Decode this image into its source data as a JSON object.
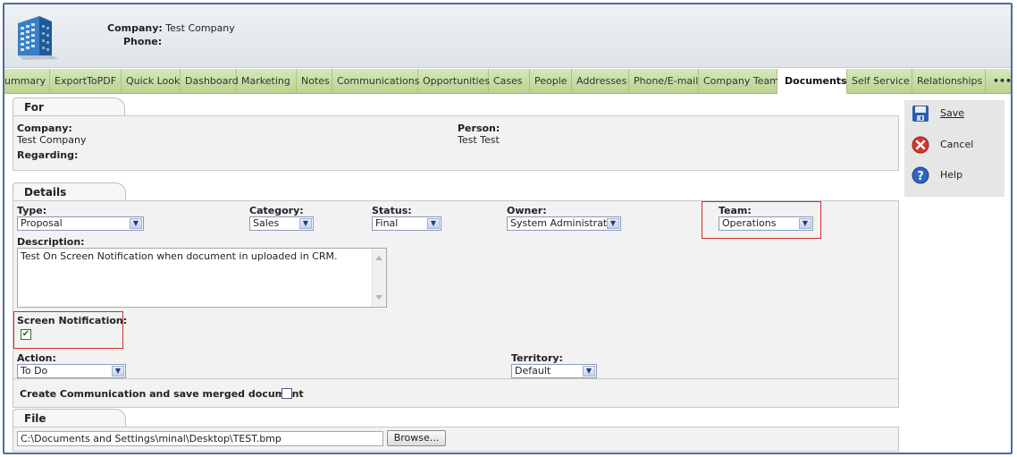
{
  "header": {
    "company_label": "Company:",
    "company_value": "Test Company",
    "phone_label": "Phone:",
    "phone_value": ""
  },
  "tabs": [
    "ummary",
    "ExportToPDF",
    "Quick Look",
    "Dashboard",
    "Marketing",
    "Notes",
    "Communications",
    "Opportunities",
    "Cases",
    "People",
    "Addresses",
    "Phone/E-mail",
    "Company Team",
    "Documents",
    "Self Service",
    "Relationships",
    "•••"
  ],
  "active_tab": "Documents",
  "for_panel": {
    "tab_label": "For",
    "company_label": "Company:",
    "company_value": "Test Company",
    "regarding_label": "Regarding:",
    "person_label": "Person:",
    "person_value": "Test Test"
  },
  "details": {
    "tab_label": "Details",
    "type_label": "Type:",
    "type_value": "Proposal",
    "category_label": "Category:",
    "category_value": "Sales",
    "status_label": "Status:",
    "status_value": "Final",
    "owner_label": "Owner:",
    "owner_value": "System Administrator",
    "team_label": "Team:",
    "team_value": "Operations",
    "description_label": "Description:",
    "description_value": "Test On Screen Notification when document in uploaded in CRM.",
    "screen_notification_label": "Screen Notification:",
    "screen_notification_checked": true,
    "action_label": "Action:",
    "action_value": "To Do",
    "territory_label": "Territory:",
    "territory_value": "Default",
    "create_comm_label": "Create Communication and save merged document",
    "create_comm_checked": false
  },
  "file_panel": {
    "tab_label": "File",
    "path_value": "C:\\Documents and Settings\\minal\\Desktop\\TEST.bmp",
    "browse_label": "Browse..."
  },
  "actions": {
    "save_label": "Save",
    "cancel_label": "Cancel",
    "help_label": "Help"
  },
  "colors": {
    "tab_bar": "#b9d38f",
    "frame": "#4a6e9c",
    "highlight": "#d12c2c"
  }
}
